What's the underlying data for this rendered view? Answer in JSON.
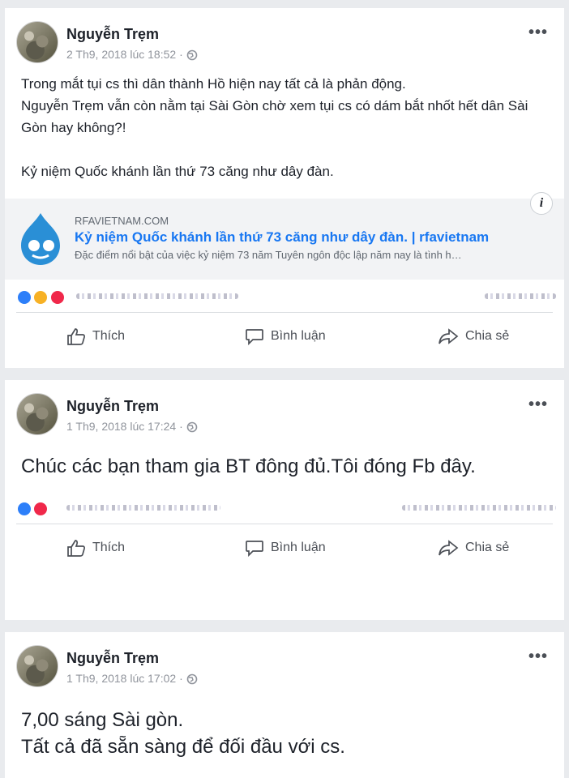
{
  "posts": [
    {
      "author": "Nguyễn Trẹm",
      "timestamp": "2 Th9, 2018 lúc 18:52 ·",
      "text": "Trong mắt tụi cs thì dân thành Hồ hiện nay tất cả là phản động.\nNguyễn Trẹm vẫn còn nằm tại Sài Gòn chờ xem tụi cs  có dám bắt nhốt hết dân Sài Gòn hay không?!\n\nKỷ niệm Quốc khánh lần thứ 73 căng như dây đàn.",
      "link": {
        "domain": "RFAVIETNAM.COM",
        "title": "Kỷ niệm Quốc khánh lần thứ 73 căng như dây đàn. | rfavietnam",
        "description": "Đặc điểm nổi bật của việc kỷ niệm 73 năm Tuyên ngôn độc lập năm nay là tình h…"
      }
    },
    {
      "author": "Nguyễn Trẹm",
      "timestamp": "1 Th9, 2018 lúc 17:24 ·",
      "text": "Chúc các bạn tham gia BT đông đủ.Tôi đóng Fb đây."
    },
    {
      "author": "Nguyễn Trẹm",
      "timestamp": "1 Th9, 2018 lúc 17:02 ·",
      "text": "7,00 sáng Sài gòn.\nTất cả đã sẵn sàng để đối đầu với cs."
    }
  ],
  "actions": {
    "like": "Thích",
    "comment": "Bình luận",
    "share": "Chia sẻ"
  },
  "info_glyph": "i",
  "more_glyph": "•••",
  "colors": {
    "link_title": "#1877f2",
    "background": "#e9ebee",
    "card": "#ffffff"
  }
}
